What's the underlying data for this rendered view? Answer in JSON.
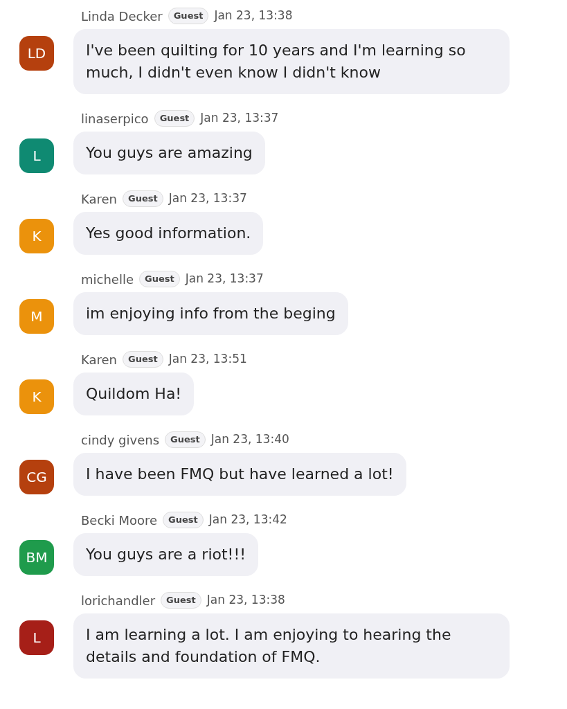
{
  "messages": [
    {
      "initials": "LD",
      "color": "#b5400e",
      "name": "Linda Decker",
      "badge": "Guest",
      "time": "Jan 23, 13:38",
      "text": "I've been quilting for 10 years and I'm learning so much, I didn't even know I didn't know"
    },
    {
      "initials": "L",
      "color": "#0f8a72",
      "name": "linaserpico",
      "badge": "Guest",
      "time": "Jan 23, 13:37",
      "text": "You guys are amazing"
    },
    {
      "initials": "K",
      "color": "#eb920c",
      "name": "Karen",
      "badge": "Guest",
      "time": "Jan 23, 13:37",
      "text": "Yes good information."
    },
    {
      "initials": "M",
      "color": "#eb920c",
      "name": "michelle",
      "badge": "Guest",
      "time": "Jan 23, 13:37",
      "text": "im enjoying info from the beging"
    },
    {
      "initials": "K",
      "color": "#eb920c",
      "name": "Karen",
      "badge": "Guest",
      "time": "Jan 23, 13:51",
      "text": "Quildom Ha!"
    },
    {
      "initials": "CG",
      "color": "#b5400e",
      "name": "cindy givens",
      "badge": "Guest",
      "time": "Jan 23, 13:40",
      "text": "I have been FMQ but have learned a lot!"
    },
    {
      "initials": "BM",
      "color": "#1f9b4c",
      "name": "Becki Moore",
      "badge": "Guest",
      "time": "Jan 23, 13:42",
      "text": "You guys are a riot!!!"
    },
    {
      "initials": "L",
      "color": "#a61f18",
      "name": "lorichandler",
      "badge": "Guest",
      "time": "Jan 23, 13:38",
      "text": "I am learning a lot. I am enjoying to hearing the details and foundation of FMQ."
    }
  ]
}
